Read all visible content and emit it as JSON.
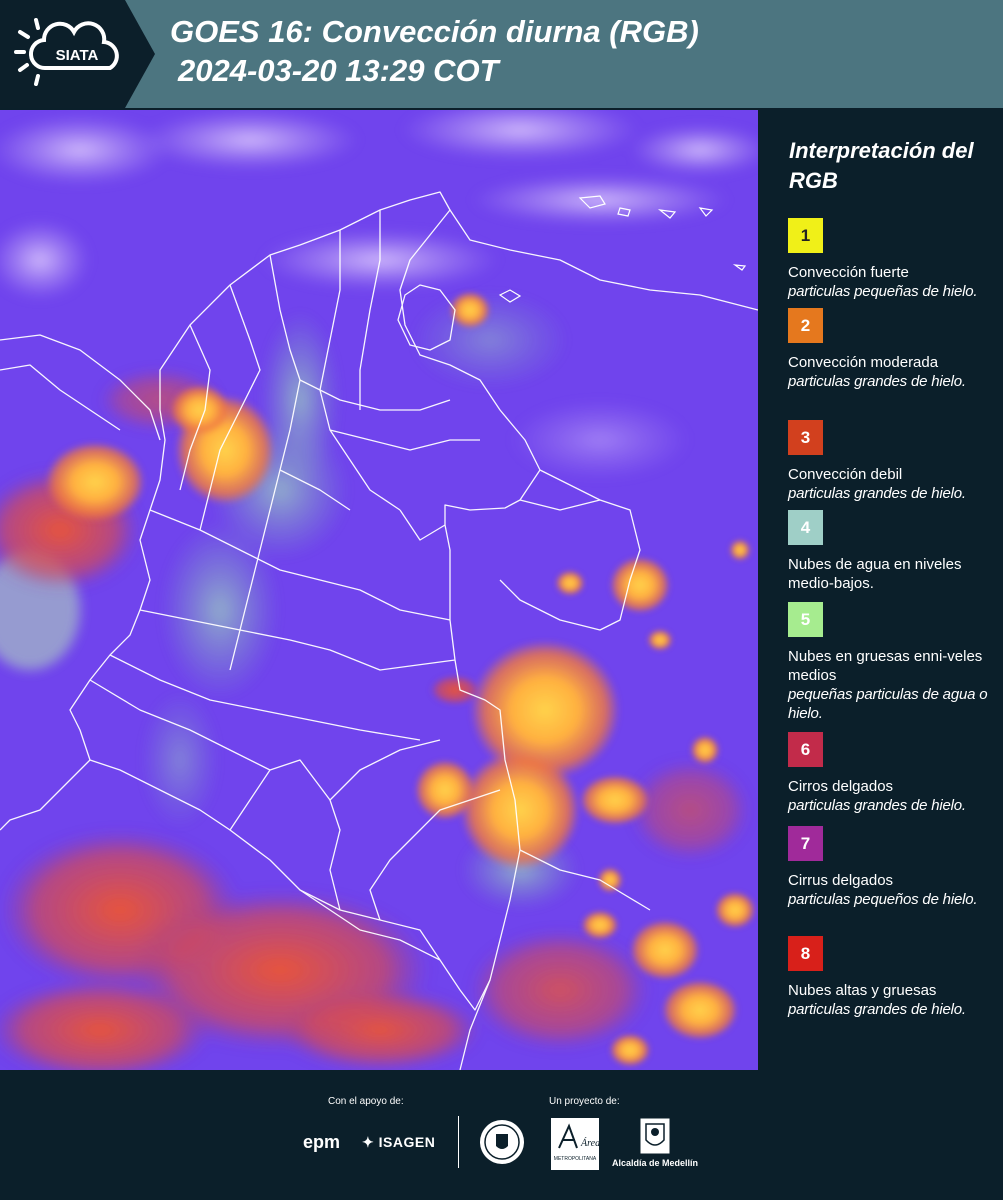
{
  "header": {
    "logo_text": "SIATA",
    "title_line1": "GOES 16: Convección diurna (RGB)",
    "title_line2": "2024-03-20 13:29 COT"
  },
  "legend": {
    "title": "Interpretación del RGB",
    "items": [
      {
        "num": "1",
        "color": "#f0f018",
        "text_color": "#222",
        "label": "Convección fuerte",
        "sub": "particulas pequeñas de hielo."
      },
      {
        "num": "2",
        "color": "#e5781e",
        "text_color": "#fff",
        "label": "Convección moderada",
        "sub": "particulas grandes de hielo."
      },
      {
        "num": "3",
        "color": "#d2401e",
        "text_color": "#fff",
        "label": "Convección debil",
        "sub": "particulas grandes de hielo."
      },
      {
        "num": "4",
        "color": "#9fcfc7",
        "text_color": "#fff",
        "label": "Nubes de agua en niveles medio-bajos.",
        "sub": ""
      },
      {
        "num": "5",
        "color": "#a6ec8f",
        "text_color": "#fff",
        "label": "Nubes en gruesas enni-veles medios",
        "sub": "pequeñas particulas de agua o hielo."
      },
      {
        "num": "6",
        "color": "#c22b4a",
        "text_color": "#fff",
        "label": "Cirros delgados",
        "sub": "particulas grandes de hielo."
      },
      {
        "num": "7",
        "color": "#a02a9a",
        "text_color": "#fff",
        "label": "Cirrus delgados",
        "sub": "particulas pequeños de hielo."
      },
      {
        "num": "8",
        "color": "#d8201a",
        "text_color": "#fff",
        "label": "Nubes altas y gruesas",
        "sub": "particulas grandes de hielo."
      }
    ]
  },
  "footer": {
    "support_label": "Con el apoyo de:",
    "project_label": "Un proyecto de:",
    "epm": "epm",
    "isagen": "ISAGEN",
    "alcaldia": "Alcaldía de Medellín",
    "area_name": "Área",
    "area_sub": "METROPOLITANA"
  }
}
